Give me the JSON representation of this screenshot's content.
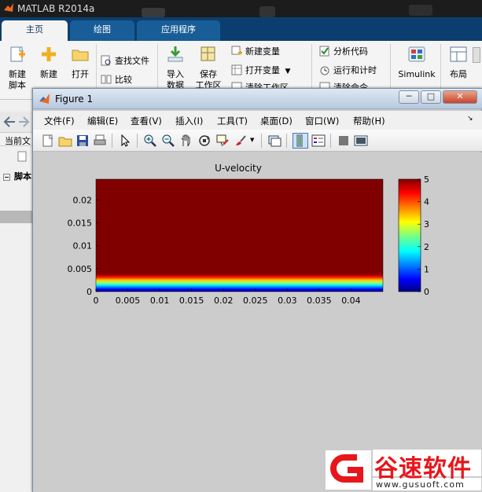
{
  "app": {
    "title": "MATLAB R2014a"
  },
  "main_tabs": [
    {
      "label": "主页"
    },
    {
      "label": "绘图"
    },
    {
      "label": "应用程序"
    }
  ],
  "ribbon": {
    "new_script": "新建\n脚本",
    "new": "新建",
    "open": "打开",
    "find_files": "查找文件",
    "compare": "比较",
    "import": "导入\n数据",
    "save_workspace": "保存\n工作区",
    "new_variable": "新建变量",
    "open_variable": "打开变量",
    "clear_workspace": "清除工作区",
    "analyze_code": "分析代码",
    "run_and_time": "运行和计时",
    "clear_commands": "清除命令",
    "simulink": "Simulink",
    "layout": "布局"
  },
  "left_panel": {
    "current_folder": "当前文",
    "script_node": "脚本"
  },
  "figure": {
    "title": "Figure 1",
    "menus": [
      "文件(F)",
      "编辑(E)",
      "查看(V)",
      "插入(I)",
      "工具(T)",
      "桌面(D)",
      "窗口(W)",
      "帮助(H)"
    ],
    "toolbar_icons": [
      "new-figure-icon",
      "open-file-icon",
      "save-icon",
      "print-icon",
      "pointer-icon",
      "zoom-in-icon",
      "zoom-out-icon",
      "pan-icon",
      "rotate-3d-icon",
      "data-cursor-icon",
      "brush-icon",
      "link-plot-icon",
      "colorbar-icon",
      "legend-icon",
      "hide-plot-tools-icon",
      "show-plot-tools-icon"
    ]
  },
  "watermark": {
    "brand": "谷速软件",
    "url": "www.gusuoft.com"
  },
  "chart_data": {
    "type": "heatmap",
    "title": "U-velocity",
    "xlabel": "",
    "ylabel": "",
    "x_ticks": [
      "0",
      "0.005",
      "0.01",
      "0.015",
      "0.02",
      "0.025",
      "0.03",
      "0.035",
      "0.04"
    ],
    "y_ticks": [
      "0",
      "0.005",
      "0.01",
      "0.015",
      "0.02"
    ],
    "xlim": [
      0,
      0.045
    ],
    "ylim": [
      0,
      0.0245
    ],
    "colormap": "jet",
    "clim": [
      0,
      5
    ],
    "colorbar_ticks": [
      "0",
      "1",
      "2",
      "3",
      "4",
      "5"
    ],
    "profile": {
      "description_axis": "y",
      "y": [
        0,
        0.0005,
        0.001,
        0.0015,
        0.002,
        0.0025,
        0.003,
        0.0035,
        0.004,
        0.0245
      ],
      "value": [
        0,
        0.6,
        1.3,
        2.0,
        2.7,
        3.4,
        4.1,
        4.7,
        5,
        5
      ]
    }
  }
}
